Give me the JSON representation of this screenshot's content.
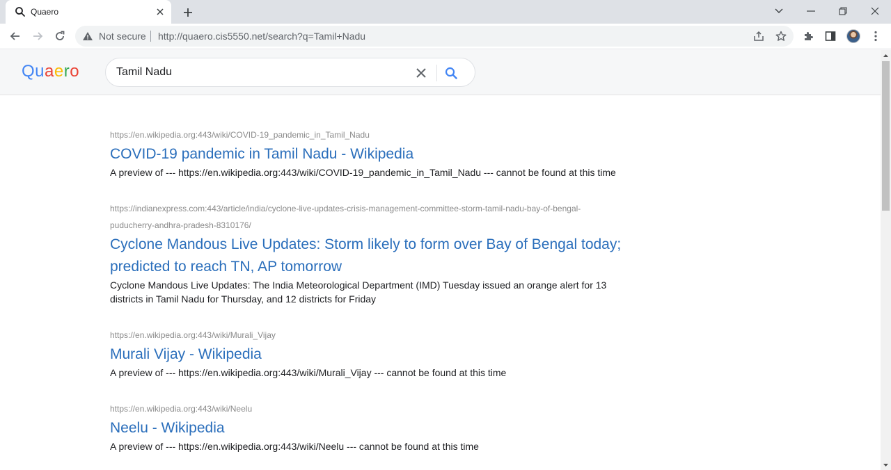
{
  "browser": {
    "tab_title": "Quaero",
    "security_label": "Not secure",
    "url": "http://quaero.cis5550.net/search?q=Tamil+Nadu"
  },
  "header": {
    "logo_letters": [
      "Q",
      "u",
      "a",
      "e",
      "r",
      "o"
    ],
    "search_value": "Tamil Nadu"
  },
  "results": [
    {
      "url_line1": "https://en.wikipedia.org:443/wiki/COVID-19_pandemic_in_Tamil_Nadu",
      "title_line1": "COVID-19 pandemic in Tamil Nadu - Wikipedia",
      "snippet_line1": "A preview of --- https://en.wikipedia.org:443/wiki/COVID-19_pandemic_in_Tamil_Nadu --- cannot be found at this time"
    },
    {
      "url_line1": "https://indianexpress.com:443/article/india/cyclone-live-updates-crisis-management-committee-storm-tamil-nadu-bay-of-bengal-",
      "url_line2": "puducherry-andhra-pradesh-8310176/",
      "title_line1": "Cyclone Mandous Live Updates: Storm likely to form over Bay of Bengal today;",
      "title_line2": "predicted to reach TN, AP tomorrow",
      "snippet_line1": "Cyclone Mandous Live Updates: The India Meteorological Department (IMD) Tuesday issued an orange alert for 13",
      "snippet_line2": "districts in Tamil Nadu for Thursday, and 12 districts for Friday"
    },
    {
      "url_line1": "https://en.wikipedia.org:443/wiki/Murali_Vijay",
      "title_line1": "Murali Vijay - Wikipedia",
      "snippet_line1": "A preview of --- https://en.wikipedia.org:443/wiki/Murali_Vijay --- cannot be found at this time"
    },
    {
      "url_line1": "https://en.wikipedia.org:443/wiki/Neelu",
      "title_line1": "Neelu - Wikipedia",
      "snippet_line1": "A preview of --- https://en.wikipedia.org:443/wiki/Neelu --- cannot be found at this time"
    }
  ],
  "colors": {
    "link": "#2a6ebb",
    "logo_blue": "#4285f4",
    "logo_red": "#ea4335",
    "logo_yellow": "#fbbc05",
    "logo_green": "#34a853"
  }
}
